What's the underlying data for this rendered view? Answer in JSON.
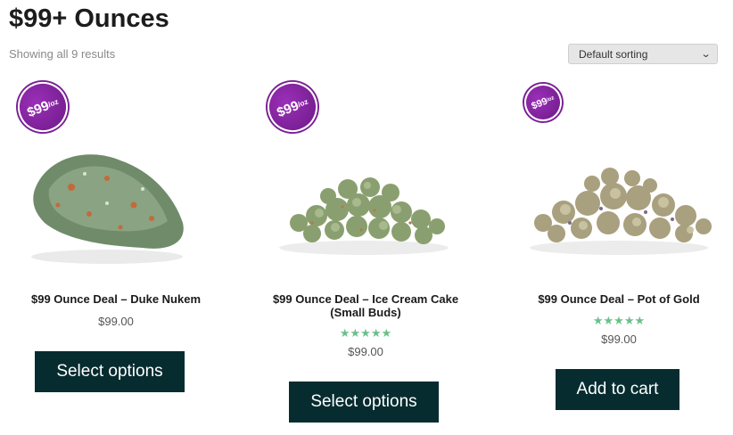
{
  "page": {
    "title": "$99+ Ounces",
    "result_count": "Showing all 9 results",
    "sorting": {
      "selected": "Default sorting"
    }
  },
  "products": [
    {
      "badge_main": "$99",
      "badge_unit": "/oz",
      "name": "$99 Ounce Deal – Duke Nukem",
      "rating": "",
      "price": "$99.00",
      "button": "Select options"
    },
    {
      "badge_main": "$99",
      "badge_unit": "/oz",
      "name": "$99 Ounce Deal – Ice Cream Cake (Small Buds)",
      "rating": "★★★★★",
      "rating_value": 5,
      "price": "$99.00",
      "button": "Select options"
    },
    {
      "badge_main": "$99",
      "badge_unit": "/oz",
      "name": "$99 Ounce Deal – Pot of Gold",
      "rating": "★★★★★",
      "rating_value": 4.5,
      "price": "$99.00",
      "button": "Add to cart"
    }
  ],
  "colors": {
    "button_bg": "#072c30",
    "badge": "#7a1f95",
    "star": "#6bbf8a"
  }
}
